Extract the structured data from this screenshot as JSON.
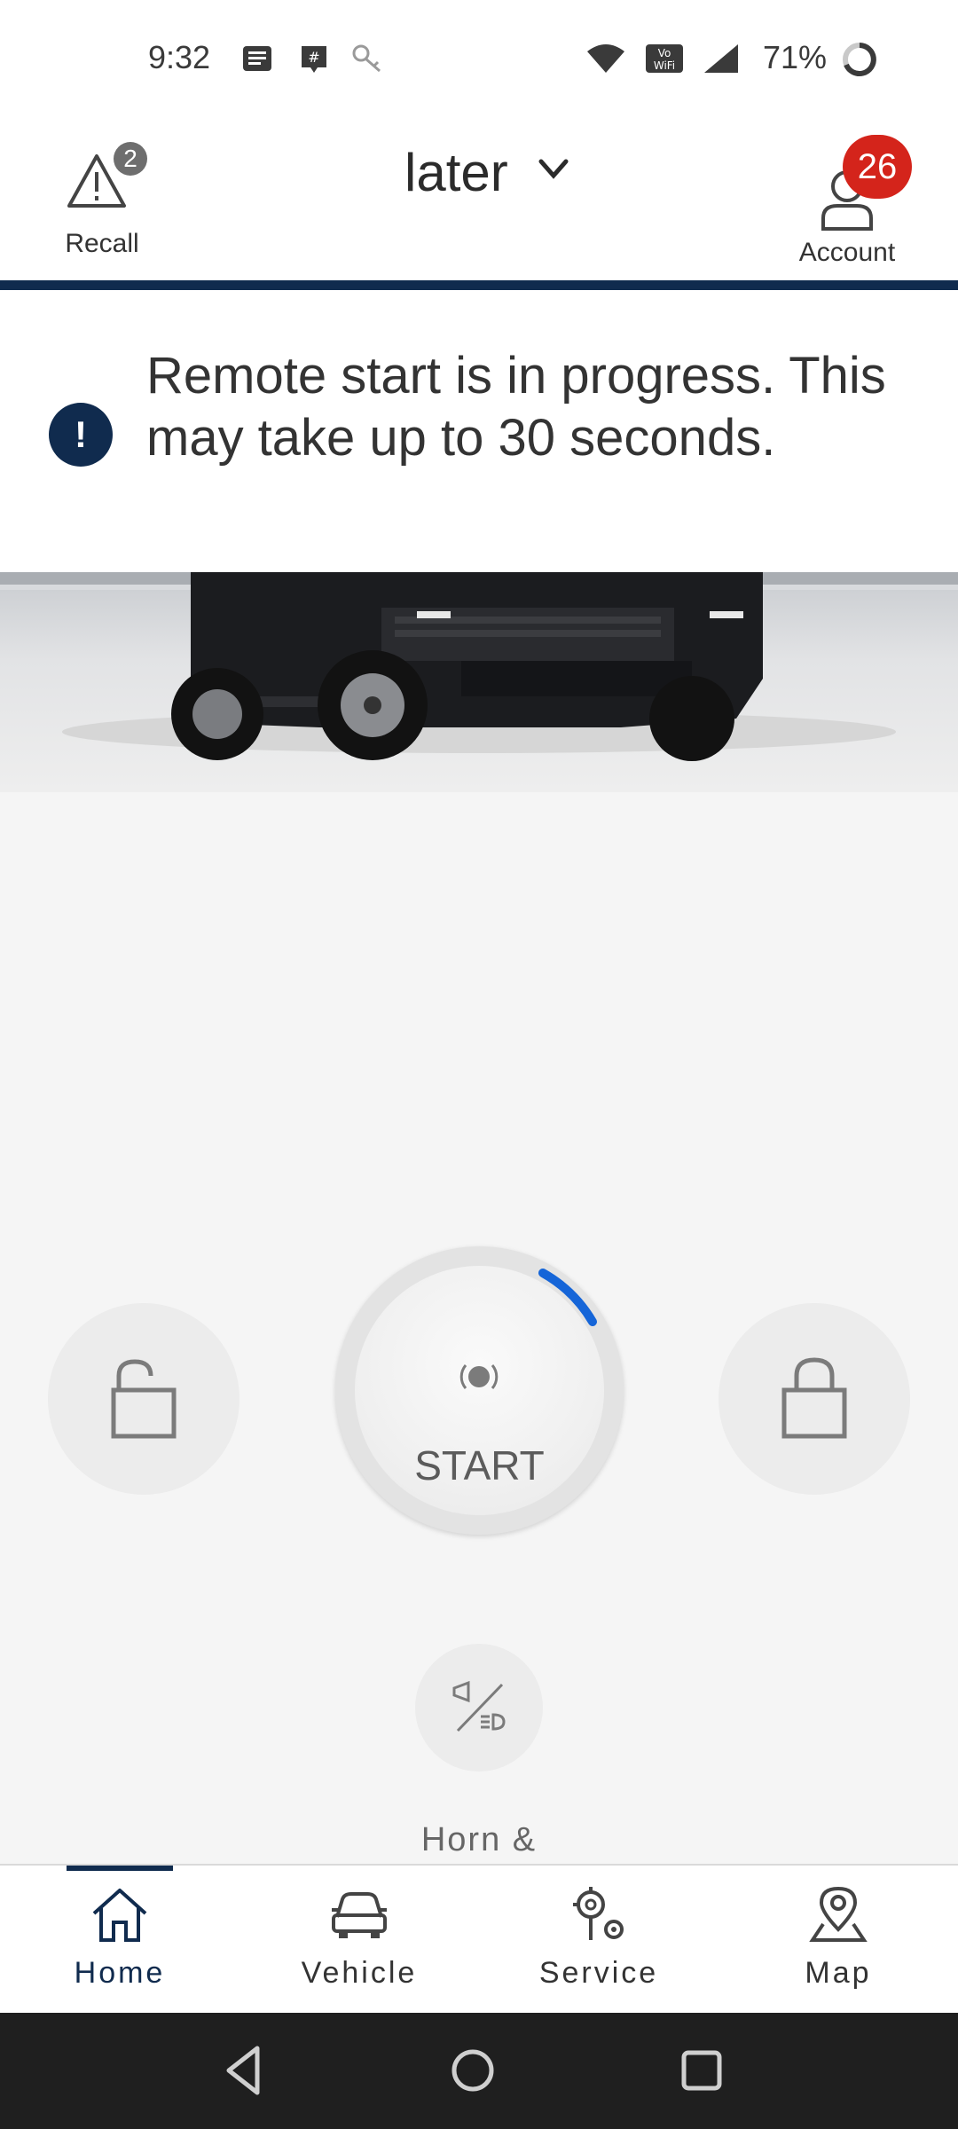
{
  "status_bar": {
    "time": "9:32",
    "battery": "71%",
    "icons": [
      "message-icon",
      "chat-icon",
      "key-icon",
      "wifi-icon",
      "vowifi-icon",
      "signal-icon",
      "battery-ring-icon"
    ]
  },
  "header": {
    "recall_label": "Recall",
    "recall_count": "2",
    "vehicle_name": "later",
    "account_label": "Account",
    "account_badge": "26"
  },
  "banner": {
    "icon": "!",
    "message": "Remote start is in progress. This may take up to 30 seconds."
  },
  "controls": {
    "unlock_icon": "unlock-icon",
    "start_label": "START",
    "lock_icon": "lock-icon",
    "horn_lights_icon": "horn-lights-icon",
    "horn_label": "Horn &"
  },
  "bottom_nav": {
    "items": [
      {
        "label": "Home",
        "icon": "home-icon",
        "active": true
      },
      {
        "label": "Vehicle",
        "icon": "car-icon",
        "active": false
      },
      {
        "label": "Service",
        "icon": "service-gears-icon",
        "active": false
      },
      {
        "label": "Map",
        "icon": "map-pin-icon",
        "active": false
      }
    ]
  },
  "colors": {
    "brand_navy": "#102b4e",
    "badge_red": "#d4241b",
    "progress_blue": "#1565d8"
  }
}
